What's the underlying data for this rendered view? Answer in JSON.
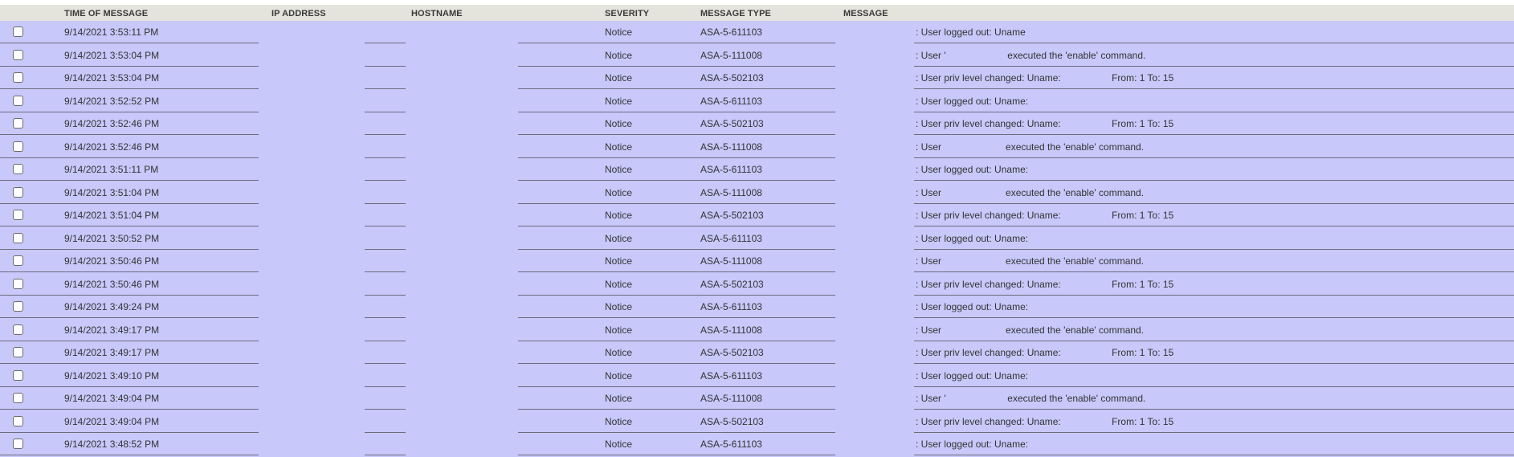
{
  "columns": {
    "time": "TIME OF MESSAGE",
    "ip": "IP ADDRESS",
    "hostname": "HOSTNAME",
    "severity": "SEVERITY",
    "message_type": "MESSAGE TYPE",
    "message": "MESSAGE"
  },
  "rows": [
    {
      "time": "9/14/2021 3:53:11 PM",
      "severity": "Notice",
      "type": "ASA-5-611103",
      "message": ": User logged out: Uname"
    },
    {
      "time": "9/14/2021 3:53:04 PM",
      "severity": "Notice",
      "type": "ASA-5-111008",
      "message": ": User '                       executed the 'enable' command."
    },
    {
      "time": "9/14/2021 3:53:04 PM",
      "severity": "Notice",
      "type": "ASA-5-502103",
      "message": ": User priv level changed: Uname:                   From: 1 To: 15"
    },
    {
      "time": "9/14/2021 3:52:52 PM",
      "severity": "Notice",
      "type": "ASA-5-611103",
      "message": ": User logged out: Uname:"
    },
    {
      "time": "9/14/2021 3:52:46 PM",
      "severity": "Notice",
      "type": "ASA-5-502103",
      "message": ": User priv level changed: Uname:                   From: 1 To: 15"
    },
    {
      "time": "9/14/2021 3:52:46 PM",
      "severity": "Notice",
      "type": "ASA-5-111008",
      "message": ": User                        executed the 'enable' command."
    },
    {
      "time": "9/14/2021 3:51:11 PM",
      "severity": "Notice",
      "type": "ASA-5-611103",
      "message": ": User logged out: Uname:"
    },
    {
      "time": "9/14/2021 3:51:04 PM",
      "severity": "Notice",
      "type": "ASA-5-111008",
      "message": ": User                        executed the 'enable' command."
    },
    {
      "time": "9/14/2021 3:51:04 PM",
      "severity": "Notice",
      "type": "ASA-5-502103",
      "message": ": User priv level changed: Uname:                   From: 1 To: 15"
    },
    {
      "time": "9/14/2021 3:50:52 PM",
      "severity": "Notice",
      "type": "ASA-5-611103",
      "message": ": User logged out: Uname:"
    },
    {
      "time": "9/14/2021 3:50:46 PM",
      "severity": "Notice",
      "type": "ASA-5-111008",
      "message": ": User                        executed the 'enable' command."
    },
    {
      "time": "9/14/2021 3:50:46 PM",
      "severity": "Notice",
      "type": "ASA-5-502103",
      "message": ": User priv level changed: Uname:                   From: 1 To: 15"
    },
    {
      "time": "9/14/2021 3:49:24 PM",
      "severity": "Notice",
      "type": "ASA-5-611103",
      "message": ": User logged out: Uname:"
    },
    {
      "time": "9/14/2021 3:49:17 PM",
      "severity": "Notice",
      "type": "ASA-5-111008",
      "message": ": User                        executed the 'enable' command."
    },
    {
      "time": "9/14/2021 3:49:17 PM",
      "severity": "Notice",
      "type": "ASA-5-502103",
      "message": ": User priv level changed: Uname:                   From: 1 To: 15"
    },
    {
      "time": "9/14/2021 3:49:10 PM",
      "severity": "Notice",
      "type": "ASA-5-611103",
      "message": ": User logged out: Uname:"
    },
    {
      "time": "9/14/2021 3:49:04 PM",
      "severity": "Notice",
      "type": "ASA-5-111008",
      "message": ": User '                       executed the 'enable' command."
    },
    {
      "time": "9/14/2021 3:49:04 PM",
      "severity": "Notice",
      "type": "ASA-5-502103",
      "message": ": User priv level changed: Uname:                   From: 1 To: 15"
    },
    {
      "time": "9/14/2021 3:48:52 PM",
      "severity": "Notice",
      "type": "ASA-5-611103",
      "message": ": User logged out: Uname:"
    }
  ],
  "colors": {
    "header_bg": "#e4e4dc",
    "row_bg": "#c8c8fb",
    "row_line": "#6c6c7e"
  }
}
